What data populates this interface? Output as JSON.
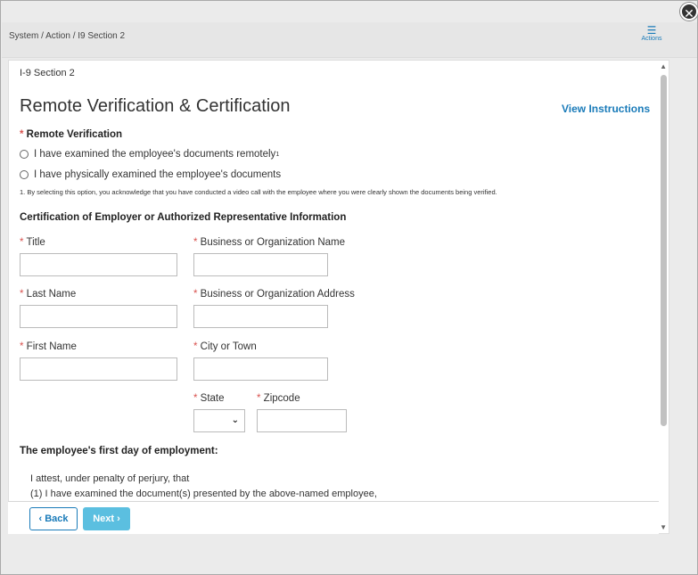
{
  "header": {
    "breadcrumb": "System / Action / I9 Section 2",
    "actions_label": "Actions",
    "actions_icon": "menu-icon",
    "close_icon": "close-icon"
  },
  "form": {
    "section_label": "I-9 Section 2",
    "title": "Remote Verification & Certification",
    "view_instructions": "View Instructions",
    "remote_verification": {
      "label": "Remote Verification",
      "options": [
        {
          "label": "I have examined the employee's documents remotely",
          "sup": "1"
        },
        {
          "label": "I have physically examined the employee's documents"
        }
      ],
      "footnote": "1. By selecting this option, you acknowledge that you have conducted a video call with the employee where you were clearly shown the documents being verified."
    },
    "certification_heading": "Certification of Employer or Authorized Representative Information",
    "fields": {
      "title": {
        "label": "Title",
        "value": ""
      },
      "business_name": {
        "label": "Business or Organization Name",
        "value": ""
      },
      "last_name": {
        "label": "Last Name",
        "value": ""
      },
      "business_address": {
        "label": "Business or Organization Address",
        "value": ""
      },
      "first_name": {
        "label": "First Name",
        "value": ""
      },
      "city": {
        "label": "City or Town",
        "value": ""
      },
      "state": {
        "label": "State",
        "value": ""
      },
      "zipcode": {
        "label": "Zipcode",
        "value": ""
      }
    },
    "first_day_label": "The employee's first day of employment:",
    "attest_line1": "I attest, under penalty of perjury, that",
    "attest_line2": "(1) I have examined the document(s) presented by the above-named employee,"
  },
  "footer": {
    "back_label": "Back",
    "next_label": "Next"
  },
  "colors": {
    "accent": "#1a7bb9",
    "required": "#d9534f",
    "next_button": "#5bbfe0"
  }
}
